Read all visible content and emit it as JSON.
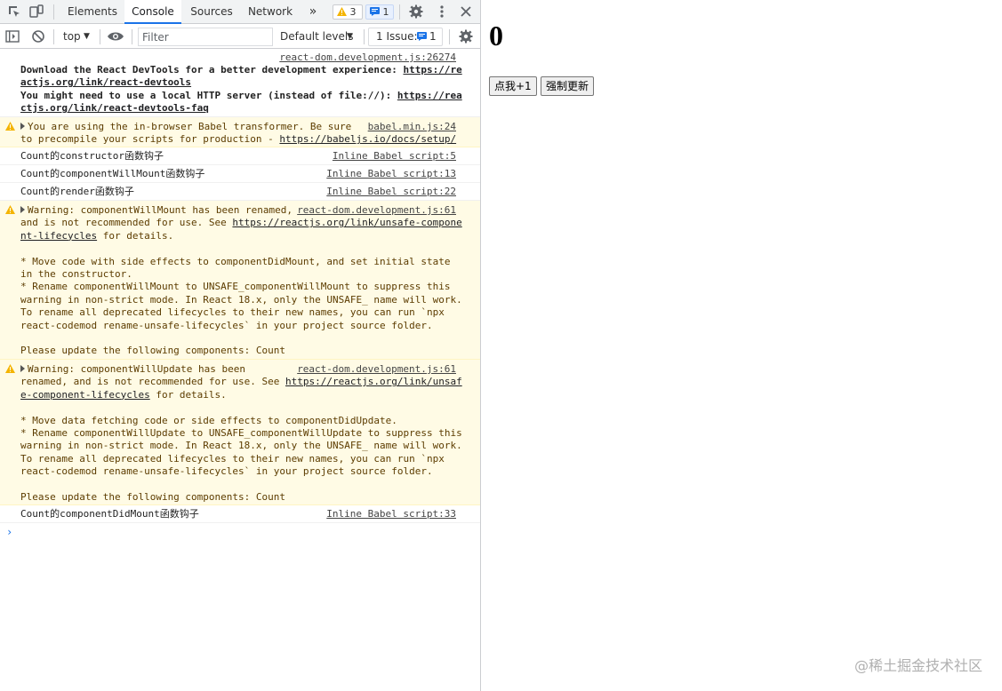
{
  "devtools": {
    "tabs": [
      {
        "label": "Elements"
      },
      {
        "label": "Console"
      },
      {
        "label": "Sources"
      },
      {
        "label": "Network"
      }
    ],
    "more_tabs": "»",
    "warning_count": "3",
    "message_count": "1",
    "toolbar": {
      "context": "top",
      "filter_placeholder": "Filter",
      "levels": "Default levels",
      "issues_label": "1 Issue:",
      "issues_count": "1"
    },
    "messages": [
      {
        "source": "react-dom.development.js:26274"
      },
      {
        "lines": [
          {
            "t": "Download the React DevTools for a better development experience: "
          },
          {
            "l": "https://re"
          },
          {
            "l": "actjs.org/link/react-devtools"
          },
          {
            "t": "You might need to use a local HTTP server (instead of file://): "
          },
          {
            "l": "https://rea"
          },
          {
            "l": "ctjs.org/link/react-devtools-faq"
          }
        ]
      },
      {
        "source": "babel.min.js:24",
        "line1": "You are using the in-browser Babel transformer. Be sure",
        "line2": "to precompile your scripts for production - ",
        "link": "https://babeljs.io/docs/setup/"
      },
      {
        "text": "Count的constructor函数钩子",
        "source": "Inline Babel script:5"
      },
      {
        "text": "Count的componentWillMount函数钩子",
        "source": "Inline Babel script:13"
      },
      {
        "text": "Count的render函数钩子",
        "source": "Inline Babel script:22"
      },
      {
        "source": "react-dom.development.js:61",
        "line1": "Warning: componentWillMount has been renamed,",
        "line2a": "and is not recommended for use. See ",
        "link1": "https://reactjs.org/link/unsafe-compone",
        "link2": "nt-lifecycles",
        "line3": " for details.",
        "rest": "\n* Move code with side effects to componentDidMount, and set initial state\nin the constructor.\n* Rename componentWillMount to UNSAFE_componentWillMount to suppress this\nwarning in non-strict mode. In React 18.x, only the UNSAFE_ name will work.\nTo rename all deprecated lifecycles to their new names, you can run `npx\nreact-codemod rename-unsafe-lifecycles` in your project source folder.\n\nPlease update the following components: Count"
      },
      {
        "source": "react-dom.development.js:61",
        "line1": "Warning: componentWillUpdate has been",
        "line2a": "renamed, and is not recommended for use. See ",
        "link1": "https://reactjs.org/link/unsaf",
        "link2": "e-component-lifecycles",
        "line3": " for details.",
        "rest": "\n* Move data fetching code or side effects to componentDidUpdate.\n* Rename componentWillUpdate to UNSAFE_componentWillUpdate to suppress this\nwarning in non-strict mode. In React 18.x, only the UNSAFE_ name will work.\nTo rename all deprecated lifecycles to their new names, you can run `npx\nreact-codemod rename-unsafe-lifecycles` in your project source folder.\n\nPlease update the following components: Count"
      },
      {
        "text": "Count的componentDidMount函数钩子",
        "source": "Inline Babel script:33"
      }
    ],
    "prompt": "›"
  },
  "page": {
    "count": "0",
    "button1": "点我+1",
    "button2": "强制更新",
    "watermark": "@稀土掘金技术社区"
  },
  "colors": {
    "warning_bg": "#fffbe5",
    "accent": "#1a73e8",
    "warning_icon": "#f4b400"
  }
}
